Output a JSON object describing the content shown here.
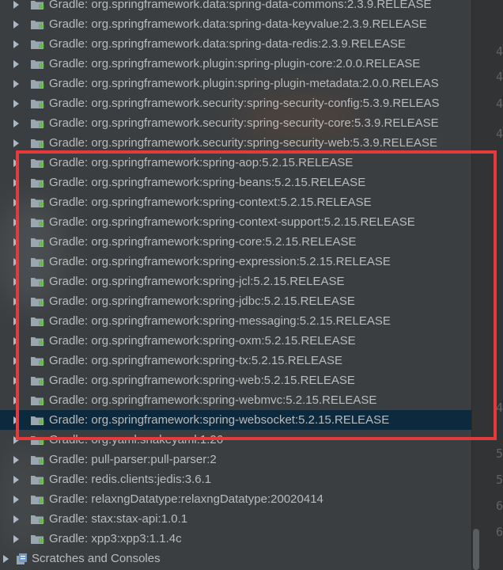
{
  "project_tree": {
    "items": [
      {
        "label": "Gradle: org.springframework.data:spring-data-commons:2.3.9.RELEASE"
      },
      {
        "label": "Gradle: org.springframework.data:spring-data-keyvalue:2.3.9.RELEASE"
      },
      {
        "label": "Gradle: org.springframework.data:spring-data-redis:2.3.9.RELEASE"
      },
      {
        "label": "Gradle: org.springframework.plugin:spring-plugin-core:2.0.0.RELEASE"
      },
      {
        "label": "Gradle: org.springframework.plugin:spring-plugin-metadata:2.0.0.RELEAS"
      },
      {
        "label": "Gradle: org.springframework.security:spring-security-config:5.3.9.RELEAS"
      },
      {
        "label": "Gradle: org.springframework.security:spring-security-core:5.3.9.RELEASE"
      },
      {
        "label": "Gradle: org.springframework.security:spring-security-web:5.3.9.RELEASE"
      },
      {
        "label": "Gradle: org.springframework:spring-aop:5.2.15.RELEASE"
      },
      {
        "label": "Gradle: org.springframework:spring-beans:5.2.15.RELEASE"
      },
      {
        "label": "Gradle: org.springframework:spring-context:5.2.15.RELEASE"
      },
      {
        "label": "Gradle: org.springframework:spring-context-support:5.2.15.RELEASE"
      },
      {
        "label": "Gradle: org.springframework:spring-core:5.2.15.RELEASE"
      },
      {
        "label": "Gradle: org.springframework:spring-expression:5.2.15.RELEASE"
      },
      {
        "label": "Gradle: org.springframework:spring-jcl:5.2.15.RELEASE"
      },
      {
        "label": "Gradle: org.springframework:spring-jdbc:5.2.15.RELEASE"
      },
      {
        "label": "Gradle: org.springframework:spring-messaging:5.2.15.RELEASE"
      },
      {
        "label": "Gradle: org.springframework:spring-oxm:5.2.15.RELEASE"
      },
      {
        "label": "Gradle: org.springframework:spring-tx:5.2.15.RELEASE"
      },
      {
        "label": "Gradle: org.springframework:spring-web:5.2.15.RELEASE"
      },
      {
        "label": "Gradle: org.springframework:spring-webmvc:5.2.15.RELEASE"
      },
      {
        "label": "Gradle: org.springframework:spring-websocket:5.2.15.RELEASE",
        "selected": true
      },
      {
        "label": "Gradle: org.yaml:snakeyaml:1.26"
      },
      {
        "label": "Gradle: pull-parser:pull-parser:2"
      },
      {
        "label": "Gradle: redis.clients:jedis:3.6.1"
      },
      {
        "label": "Gradle: relaxngDatatype:relaxngDatatype:20020414"
      },
      {
        "label": "Gradle: stax:stax-api:1.0.1"
      },
      {
        "label": "Gradle: xpp3:xpp3:1.1.4c"
      }
    ],
    "scratches_label": "Scratches and Consoles"
  },
  "gutter": {
    "numbers": [
      "4",
      "4",
      "4",
      "4",
      "4",
      "5",
      "5",
      "6",
      "6"
    ]
  },
  "colors": {
    "background": "#3b3e40",
    "text": "#bbbbbb",
    "selection": "#0d293e",
    "highlight_box": "#e33b3b",
    "library_icon_folder": "#9aa7b0",
    "library_icon_bars": "#62b543"
  },
  "icons": {
    "expand": "chevron-right-icon",
    "library": "library-icon",
    "scratches": "scratches-icon"
  }
}
